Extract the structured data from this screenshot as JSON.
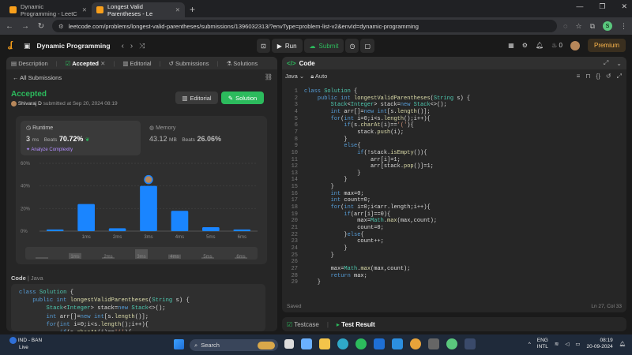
{
  "browser": {
    "tabs": [
      {
        "title": "Dynamic Programming - LeetC",
        "active": false
      },
      {
        "title": "Longest Valid Parentheses - Le",
        "active": true
      }
    ],
    "url": "leetcode.com/problems/longest-valid-parentheses/submissions/1396032313/?envType=problem-list-v2&envId=dynamic-programming",
    "profile_initial": "S"
  },
  "lcnav": {
    "list_title": "Dynamic Programming",
    "run": "Run",
    "submit": "Submit",
    "streak": "0",
    "premium": "Premium"
  },
  "left": {
    "tabs": [
      "Description",
      "Accepted",
      "Editorial",
      "Submissions",
      "Solutions"
    ],
    "all_submissions": "All Submissions",
    "status": "Accepted",
    "author": "Shivaraj D",
    "submitted": "submitted at Sep 20, 2024 08:19",
    "editorial_btn": "Editorial",
    "solution_btn": "Solution",
    "runtime": {
      "label": "Runtime",
      "value": "3",
      "unit": "ms",
      "beats_label": "Beats",
      "beats": "70.72%"
    },
    "memory": {
      "label": "Memory",
      "value": "43.12",
      "unit": "MB",
      "beats_label": "Beats",
      "beats": "26.06%"
    },
    "analyze": "Analyze Complexity",
    "code_label": "Code",
    "code_lang": "Java"
  },
  "chart_data": {
    "type": "bar",
    "categories": [
      "",
      "1ms",
      "2ms",
      "3ms",
      "4ms",
      "5ms",
      "6ms"
    ],
    "values": [
      1.5,
      24,
      2.5,
      40,
      18,
      3.5,
      1.5
    ],
    "ylim": [
      0,
      60
    ],
    "yticks": [
      "60%",
      "40%",
      "20%",
      "0%"
    ],
    "xlabel": "",
    "ylabel": "",
    "highlight_index": 3,
    "bar_color": "#1a85ff"
  },
  "slider_labels": [
    "",
    "1ms",
    "2ms",
    "3ms",
    "4ms",
    "5ms",
    "6ms"
  ],
  "right": {
    "title": "Code",
    "lang": "Java",
    "mode": "Auto",
    "saved": "Saved",
    "cursor": "Ln 27, Col 33",
    "testcase": "Testcase",
    "test_result": "Test Result"
  },
  "code_lines": [
    "class Solution {",
    "    public int longestValidParentheses(String s) {",
    "        Stack<Integer> stack=new Stack<>();",
    "        int arr[]=new int[s.length()];",
    "        for(int i=0;i<s.length();i++){",
    "            if(s.charAt(i)=='('){",
    "                stack.push(i);",
    "            }",
    "            else{",
    "                if(!stack.isEmpty()){",
    "                    arr[i]=1;",
    "                    arr[stack.pop()]=1;",
    "                }",
    "            }",
    "        }",
    "        int max=0;",
    "        int count=0;",
    "        for(int i=0;i<arr.length;i++){",
    "            if(arr[i]==0){",
    "                max=Math.max(max,count);",
    "                count=0;",
    "            }else{",
    "                count++;",
    "            }",
    "        }",
    "",
    "        max=Math.max(max,count);",
    "        return max;",
    "    }"
  ],
  "line_numbers": [
    "1",
    "2",
    "3",
    "4",
    "5",
    "6",
    "7",
    "8",
    "9",
    "10",
    "11",
    "12",
    "13",
    "14",
    "15",
    "16",
    "17",
    "18",
    "19",
    "20",
    "21",
    "22",
    "23",
    "24",
    "25",
    "26",
    "27",
    "28",
    "29"
  ],
  "taskbar": {
    "weather_line1": "IND - BAN",
    "weather_line2": "Live",
    "search": "Search",
    "lang1": "ENG",
    "lang2": "INTL",
    "time": "08:19",
    "date": "20-09-2024"
  }
}
